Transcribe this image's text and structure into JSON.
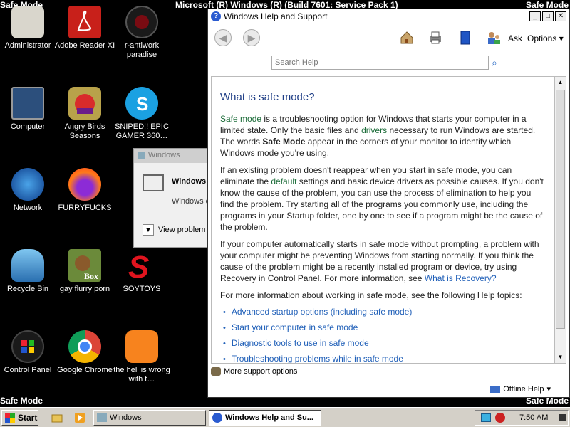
{
  "safe_mode_label": "Safe Mode",
  "build_text": "Microsoft (R) Windows (R) (Build 7601: Service Pack 1)",
  "desktop_icons": [
    {
      "label": "Administrator"
    },
    {
      "label": "Adobe Reader XI"
    },
    {
      "label": "r-antiwork paradise"
    },
    {
      "label": "Computer"
    },
    {
      "label": "Angry Birds Seasons"
    },
    {
      "label": "SNIPED!! EPIC GAMER 360…"
    },
    {
      "label": "Network"
    },
    {
      "label": "FURRYFUCKS"
    },
    {
      "label": "Recycle Bin"
    },
    {
      "label": "gay flurry porn"
    },
    {
      "label": "SOYTOYS"
    },
    {
      "label": "Control Panel"
    },
    {
      "label": "Google Chrome"
    },
    {
      "label": "the hell is wrong with t…"
    }
  ],
  "bg_dialog": {
    "title": "Windows",
    "heading": "Windows",
    "subtext": "Windows c",
    "view_problem": "View problem"
  },
  "help_window": {
    "title": "Windows Help and Support",
    "title_qmark": "?",
    "toolbar": {
      "ask": "Ask",
      "options": "Options"
    },
    "search_placeholder": "Search Help",
    "heading": "What is safe mode?",
    "p1": {
      "link_safe_mode": "Safe mode",
      "t1": " is a troubleshooting option for Windows that starts your computer in a limited state. Only the basic files and ",
      "link_drivers": "drivers",
      "t2": " necessary to run Windows are started. The words ",
      "bold": "Safe Mode",
      "t3": " appear in the corners of your monitor to identify which Windows mode you're using."
    },
    "p2": {
      "t1": "If an existing problem doesn't reappear when you start in safe mode, you can eliminate the ",
      "link_default": "default",
      "t2": " settings and basic device drivers as possible causes. If you don't know the cause of the problem, you can use the process of elimination to help you find the problem. Try starting all of the programs you commonly use, including the programs in your Startup folder, one by one to see if a program might be the cause of the problem."
    },
    "p3": {
      "t1": "If your computer automatically starts in safe mode without prompting, a problem with your computer might be preventing Windows from starting normally. If you think the cause of the problem might be a recently installed program or device, try using Recovery in Control Panel. For more information, see ",
      "link_recovery": "What is Recovery?"
    },
    "p4": "For more information about working in safe mode, see the following Help topics:",
    "topics": [
      "Advanced startup options (including safe mode)",
      "Start your computer in safe mode",
      "Diagnostic tools to use in safe mode",
      "Troubleshooting problems while in safe mode"
    ],
    "more_support": "More support options",
    "offline_help": "Offline Help"
  },
  "taskbar": {
    "start": "Start",
    "tasks": [
      "Windows",
      "Windows Help and Su..."
    ],
    "clock": "7:50 AM"
  }
}
